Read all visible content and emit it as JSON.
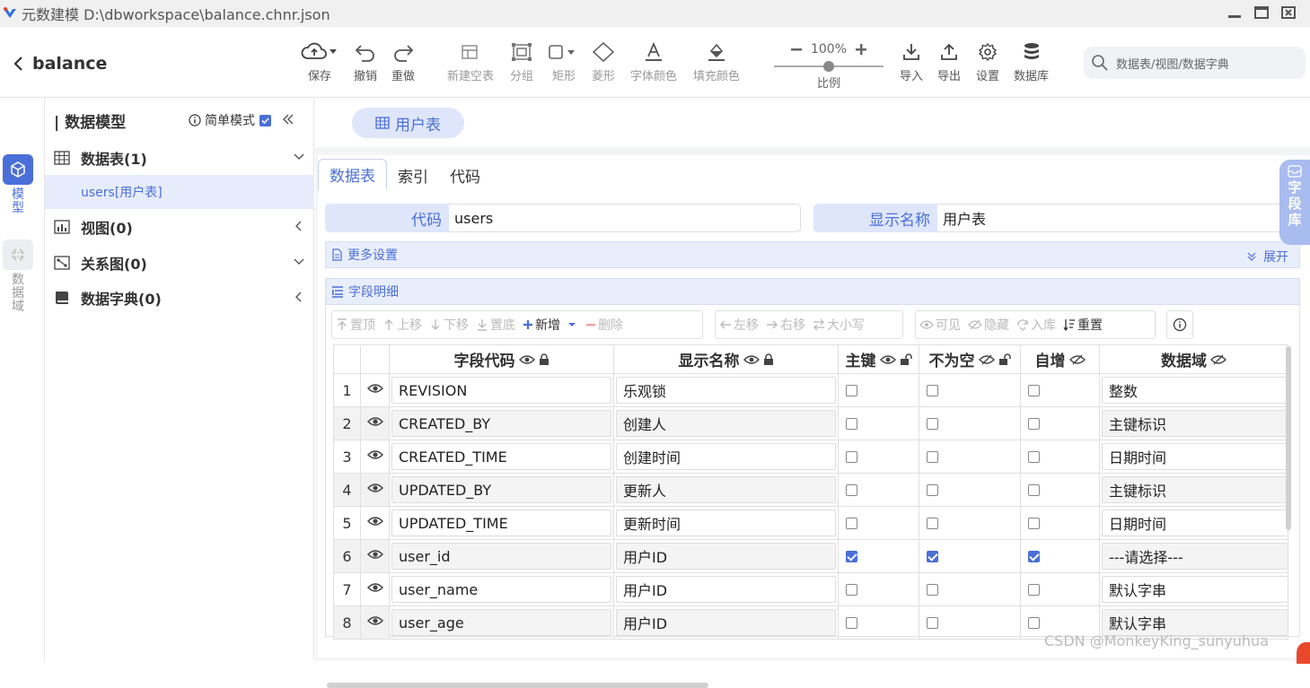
{
  "window": {
    "title": "元数建模  D:\\dbworkspace\\balance.chnr.json"
  },
  "header": {
    "back_label": "balance"
  },
  "toolbar": {
    "save": "保存",
    "undo": "撤销",
    "redo": "重做",
    "new_table": "新建空表",
    "group": "分组",
    "rect": "矩形",
    "diamond": "菱形",
    "font_color": "字体颜色",
    "fill_color": "填充颜色",
    "zoom": "100%",
    "zoom_label": "比例",
    "zoom_level": 0.5,
    "import": "导入",
    "export": "导出",
    "settings": "设置",
    "database": "数据库"
  },
  "search": {
    "placeholder": "数据表/视图/数据字典"
  },
  "rail": {
    "model": "模型",
    "domain": "数据域"
  },
  "tree": {
    "title": "| 数据模型",
    "simple_mode": "简单模式",
    "nodes": {
      "tables": "数据表(1)",
      "views": "视图(0)",
      "relations": "关系图(0)",
      "dicts": "数据字典(0)"
    },
    "selected_table": "users[用户表]"
  },
  "tab": {
    "label": "用户表"
  },
  "subtabs": {
    "table": "数据表",
    "index": "索引",
    "code": "代码"
  },
  "form": {
    "code_label": "代码",
    "code_value": "users",
    "display_label": "显示名称",
    "display_value": "用户表"
  },
  "more_settings": {
    "label": "更多设置",
    "expand": "展开"
  },
  "field_detail": {
    "label": "字段明细"
  },
  "grid_toolbar": {
    "top": "置顶",
    "up": "上移",
    "down": "下移",
    "bottom": "置底",
    "add": "新增",
    "delete": "删除",
    "left": "左移",
    "right": "右移",
    "case": "大小写",
    "visible": "可见",
    "hide": "隐藏",
    "to_lib": "入库",
    "reset": "重置"
  },
  "columns": {
    "code": "字段代码",
    "name": "显示名称",
    "pk": "主键",
    "notnull": "不为空",
    "autoinc": "自增",
    "domain": "数据域"
  },
  "rows": [
    {
      "n": "1",
      "code": "REVISION",
      "name": "乐观锁",
      "domain": "整数"
    },
    {
      "n": "2",
      "code": "CREATED_BY",
      "name": "创建人",
      "domain": "主键标识"
    },
    {
      "n": "3",
      "code": "CREATED_TIME",
      "name": "创建时间",
      "domain": "日期时间"
    },
    {
      "n": "4",
      "code": "UPDATED_BY",
      "name": "更新人",
      "domain": "主键标识"
    },
    {
      "n": "5",
      "code": "UPDATED_TIME",
      "name": "更新时间",
      "domain": "日期时间"
    },
    {
      "n": "6",
      "code": "user_id",
      "name": "用户ID",
      "domain": "---请选择---"
    },
    {
      "n": "7",
      "code": "user_name",
      "name": "用户ID",
      "domain": "默认字串"
    },
    {
      "n": "8",
      "code": "user_age",
      "name": "用户ID",
      "domain": "默认字串"
    }
  ],
  "side_panel": {
    "label": "字段库"
  },
  "watermark": "CSDN @MonkeyKing_sunyuhua"
}
